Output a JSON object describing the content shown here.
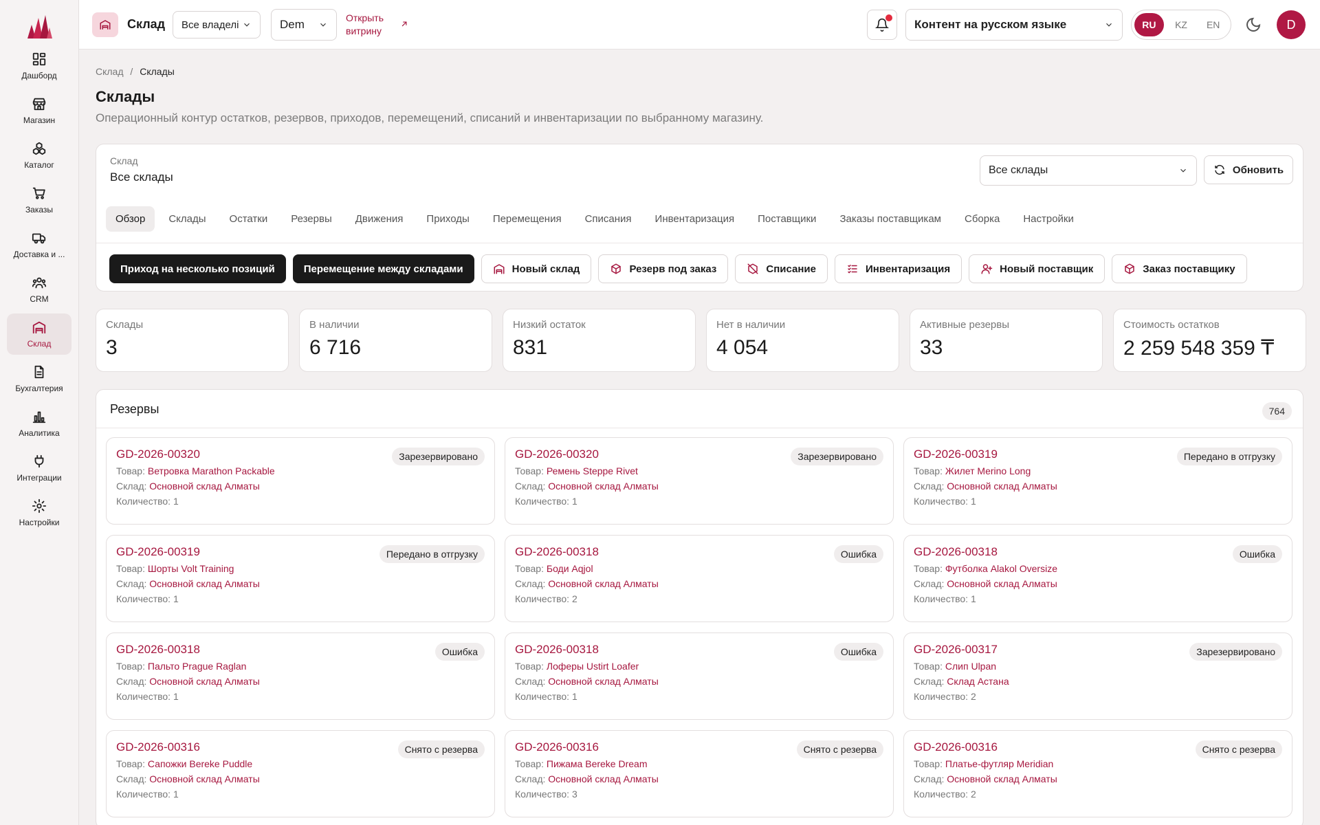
{
  "sidebar": {
    "items": [
      {
        "label": "Дашборд",
        "icon": "dashboard-icon"
      },
      {
        "label": "Магазин",
        "icon": "store-icon"
      },
      {
        "label": "Каталог",
        "icon": "catalog-icon"
      },
      {
        "label": "Заказы",
        "icon": "cart-icon"
      },
      {
        "label": "Доставка и ...",
        "icon": "truck-icon"
      },
      {
        "label": "CRM",
        "icon": "users-icon"
      },
      {
        "label": "Склад",
        "icon": "warehouse-icon"
      },
      {
        "label": "Бухгалтерия",
        "icon": "document-icon"
      },
      {
        "label": "Аналитика",
        "icon": "bar-chart-icon"
      },
      {
        "label": "Интеграции",
        "icon": "plug-icon"
      },
      {
        "label": "Настройки",
        "icon": "gear-icon"
      }
    ],
    "active_index": 6
  },
  "topbar": {
    "title": "Склад",
    "owner_select": "Все владелі",
    "store_select": "Dem",
    "open_link": "Открыть витрину",
    "content_lang_select": "Контент на русском языке",
    "langs": [
      "RU",
      "KZ",
      "EN"
    ],
    "active_lang": "RU",
    "avatar_initial": "D"
  },
  "breadcrumb": {
    "parent": "Склад",
    "separator": "/",
    "current": "Склады"
  },
  "page": {
    "title": "Склады",
    "subtitle": "Операционный контур остатков, резервов, приходов, перемещений, списаний и инвентаризации по выбранному магазину."
  },
  "warehouse_panel": {
    "label": "Склад",
    "value": "Все склады",
    "select": "Все склады",
    "refresh_label": "Обновить",
    "tabs": [
      "Обзор",
      "Склады",
      "Остатки",
      "Резервы",
      "Движения",
      "Приходы",
      "Перемещения",
      "Списания",
      "Инвентаризация",
      "Поставщики",
      "Заказы поставщикам",
      "Сборка",
      "Настройки"
    ],
    "active_tab": "Обзор",
    "actions": [
      {
        "label": "Приход на несколько позиций",
        "style": "dark"
      },
      {
        "label": "Перемещение между складами",
        "style": "dark"
      },
      {
        "label": "Новый склад",
        "style": "light",
        "icon": "warehouse-icon"
      },
      {
        "label": "Резерв под заказ",
        "style": "light",
        "icon": "box-icon"
      },
      {
        "label": "Списание",
        "style": "light",
        "icon": "box-off-icon"
      },
      {
        "label": "Инвентаризация",
        "style": "light",
        "icon": "checklist-icon"
      },
      {
        "label": "Новый поставщик",
        "style": "light",
        "icon": "user-plus-icon"
      },
      {
        "label": "Заказ поставщику",
        "style": "light",
        "icon": "box-icon"
      }
    ]
  },
  "stats": [
    {
      "label": "Склады",
      "value": "3"
    },
    {
      "label": "В наличии",
      "value": "6 716"
    },
    {
      "label": "Низкий остаток",
      "value": "831"
    },
    {
      "label": "Нет в наличии",
      "value": "4 054"
    },
    {
      "label": "Активные резервы",
      "value": "33"
    },
    {
      "label": "Стоимость остатков",
      "value": "2 259 548 359 ₸"
    }
  ],
  "reserves": {
    "title": "Резервы",
    "count": "764",
    "product_prefix": "Товар:",
    "warehouse_prefix": "Склад:",
    "qty_prefix": "Количество:",
    "items": [
      {
        "code": "GD-2026-00320",
        "status": "Зарезервировано",
        "product": "Ветровка Marathon Packable",
        "warehouse": "Основной склад Алматы",
        "qty": "1"
      },
      {
        "code": "GD-2026-00320",
        "status": "Зарезервировано",
        "product": "Ремень Steppe Rivet",
        "warehouse": "Основной склад Алматы",
        "qty": "1"
      },
      {
        "code": "GD-2026-00319",
        "status": "Передано в отгрузку",
        "product": "Жилет Merino Long",
        "warehouse": "Основной склад Алматы",
        "qty": "1"
      },
      {
        "code": "GD-2026-00319",
        "status": "Передано в отгрузку",
        "product": "Шорты Volt Training",
        "warehouse": "Основной склад Алматы",
        "qty": "1"
      },
      {
        "code": "GD-2026-00318",
        "status": "Ошибка",
        "product": "Боди Aqjol",
        "warehouse": "Основной склад Алматы",
        "qty": "2"
      },
      {
        "code": "GD-2026-00318",
        "status": "Ошибка",
        "product": "Футболка Alakol Oversize",
        "warehouse": "Основной склад Алматы",
        "qty": "1"
      },
      {
        "code": "GD-2026-00318",
        "status": "Ошибка",
        "product": "Пальто Prague Raglan",
        "warehouse": "Основной склад Алматы",
        "qty": "1"
      },
      {
        "code": "GD-2026-00318",
        "status": "Ошибка",
        "product": "Лоферы Ustirt Loafer",
        "warehouse": "Основной склад Алматы",
        "qty": "1"
      },
      {
        "code": "GD-2026-00317",
        "status": "Зарезервировано",
        "product": "Слип Ulpan",
        "warehouse": "Склад Астана",
        "qty": "2"
      },
      {
        "code": "GD-2026-00316",
        "status": "Снято с резерва",
        "product": "Сапожки Bereke Puddle",
        "warehouse": "Основной склад Алматы",
        "qty": "1"
      },
      {
        "code": "GD-2026-00316",
        "status": "Снято с резерва",
        "product": "Пижама Bereke Dream",
        "warehouse": "Основной склад Алматы",
        "qty": "3"
      },
      {
        "code": "GD-2026-00316",
        "status": "Снято с резерва",
        "product": "Платье-футляр Meridian",
        "warehouse": "Основной склад Алматы",
        "qty": "2"
      }
    ]
  },
  "colors": {
    "accent": "#a6173f",
    "accent_bg": "#f6d6dd",
    "dark_button": "#1a1a1a",
    "notification_dot": "#e32b3e"
  }
}
